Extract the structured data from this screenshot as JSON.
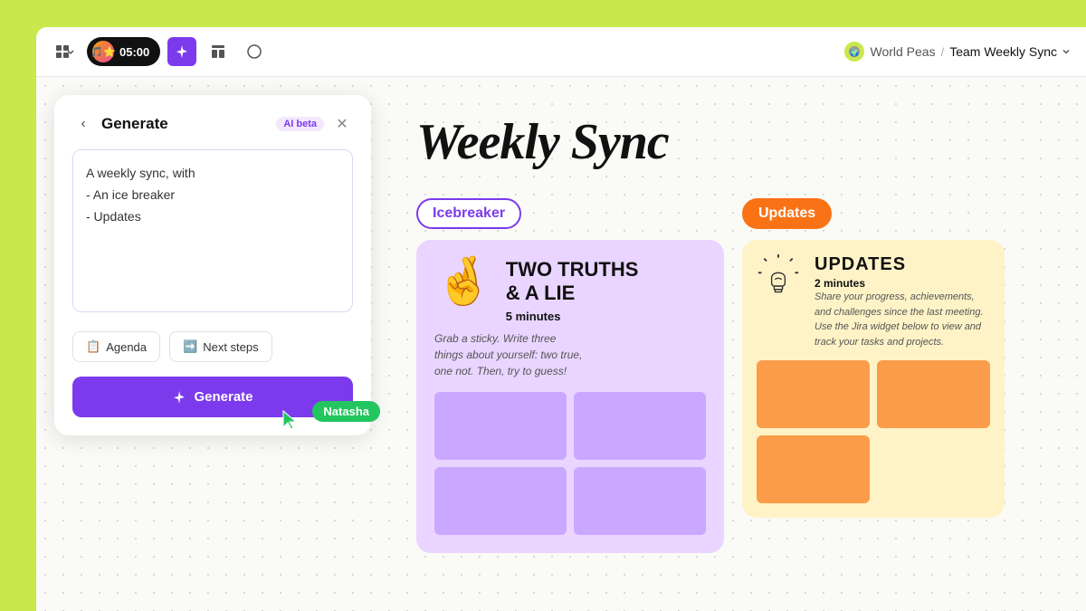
{
  "topbar": {
    "timer": "05:00",
    "breadcrumb_workspace": "World Peas",
    "breadcrumb_doc": "Team Weekly Sync",
    "tools": [
      {
        "label": "grid-icon",
        "unicode": "⊞"
      },
      {
        "label": "layout-icon",
        "unicode": "▣"
      },
      {
        "label": "chat-icon",
        "unicode": "○"
      }
    ]
  },
  "generate_panel": {
    "title": "Generate",
    "ai_badge": "AI beta",
    "prompt_text": "A weekly sync, with\n- An ice breaker\n- Updates",
    "chips": [
      {
        "icon": "📋",
        "label": "Agenda"
      },
      {
        "icon": "➡️",
        "label": "Next steps"
      }
    ],
    "generate_button": "Generate",
    "cursor_name": "Natasha"
  },
  "canvas": {
    "page_title": "Weekly Sync",
    "icebreaker_label": "Icebreaker",
    "icebreaker_card": {
      "title_line1": "TWO TRUTHS",
      "title_line2": "& A LIE",
      "minutes": "5 minutes",
      "description": "Grab a sticky. Write three\nthings about yourself: two true,\none not. Then, try to guess!"
    },
    "updates_label": "Updates",
    "updates_card": {
      "title": "UPDATES",
      "minutes": "2 minutes",
      "description": "Share your progress, achievements, and challenges since the last meeting. Use the Jira widget below to view and track your tasks and projects."
    }
  }
}
